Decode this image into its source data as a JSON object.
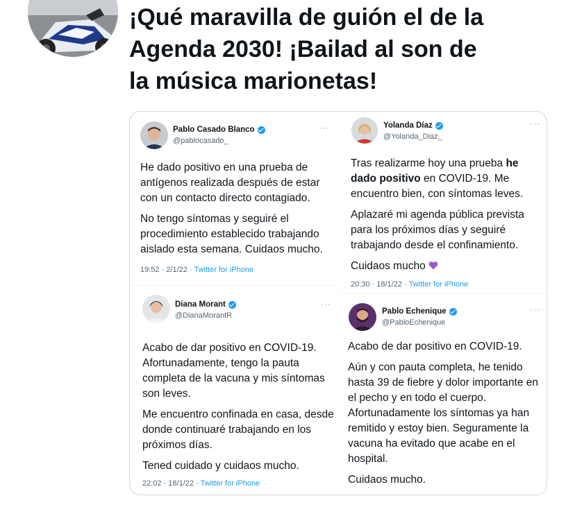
{
  "post": {
    "text": "¡Qué maravilla de guión el de la\nAgenda 2030! ¡Bailad al son de\nla música  marionetas!"
  },
  "tweets": [
    {
      "name": "Pablo Casado Blanco",
      "handle": "@pablocasado_",
      "paragraphs": [
        "He dado positivo en una prueba de antígenos realizada después de estar con un contacto directo contagiado.",
        "No tengo síntomas y seguiré el procedimiento establecido trabajando aislado esta semana. Cuidaos mucho."
      ],
      "time": "19:52 · 2/1/22 · ",
      "source": "Twitter for iPhone"
    },
    {
      "name": "Yolanda Díaz",
      "handle": "@Yolanda_Diaz_",
      "p1_before": "Tras realizarme hoy una prueba ",
      "p1_bold": "he dado positivo",
      "p1_after": " en COVID-19. Me encuentro bien, con síntomas leves.",
      "p2": "Aplazaré mi agenda pública prevista para los próximos días y seguiré trabajando desde el confinamiento.",
      "p3": "Cuidaos mucho",
      "time": "20:30 · 18/1/22 · ",
      "source": "Twitter for iPhone"
    },
    {
      "name": "Diana Morant",
      "handle": "@DianaMorantR",
      "paragraphs": [
        "Acabo de dar positivo en COVID-19. Afortunadamente, tengo la pauta completa de la vacuna y mis síntomas son leves.",
        "Me encuentro confinada en casa, desde donde continuaré trabajando en los próximos días.",
        "Tened cuidado y cuidaos mucho."
      ],
      "time": "22:02 · 18/1/22 · ",
      "source": "Twitter for iPhone"
    },
    {
      "name": "Pablo Echenique",
      "handle": "@PabloEchenique",
      "paragraphs": [
        "Acabo de dar positivo en COVID-19.",
        "Aún y con pauta completa, he tenido hasta 39 de fiebre y dolor importante en el pecho y en todo el cuerpo. Afortunadamente los síntomas ya han remitido y estoy bien. Seguramente la vacuna ha evitado que acabe en el hospital.",
        "Cuidaos mucho."
      ]
    }
  ],
  "colors": {
    "verified": "#1d9bf0",
    "link": "#1d9bf0",
    "meta": "#536471",
    "heart": "#9b59d0"
  }
}
